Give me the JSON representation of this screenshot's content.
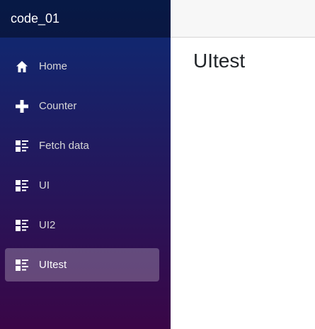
{
  "app": {
    "brand": "code_01"
  },
  "sidebar": {
    "items": [
      {
        "label": "Home",
        "icon": "home-icon",
        "active": false
      },
      {
        "label": "Counter",
        "icon": "plus-icon",
        "active": false
      },
      {
        "label": "Fetch data",
        "icon": "list-rich-icon",
        "active": false
      },
      {
        "label": "UI",
        "icon": "list-rich-icon",
        "active": false
      },
      {
        "label": "UI2",
        "icon": "list-rich-icon",
        "active": false
      },
      {
        "label": "UItest",
        "icon": "list-rich-icon",
        "active": true
      }
    ]
  },
  "main": {
    "heading": "UItest"
  },
  "colors": {
    "sidebar_gradient_top": "#0c2b74",
    "sidebar_gradient_bottom": "#3a0647",
    "active_item_bg": "rgba(255,255,255,0.25)",
    "top_row_bg": "#f7f7f7"
  }
}
